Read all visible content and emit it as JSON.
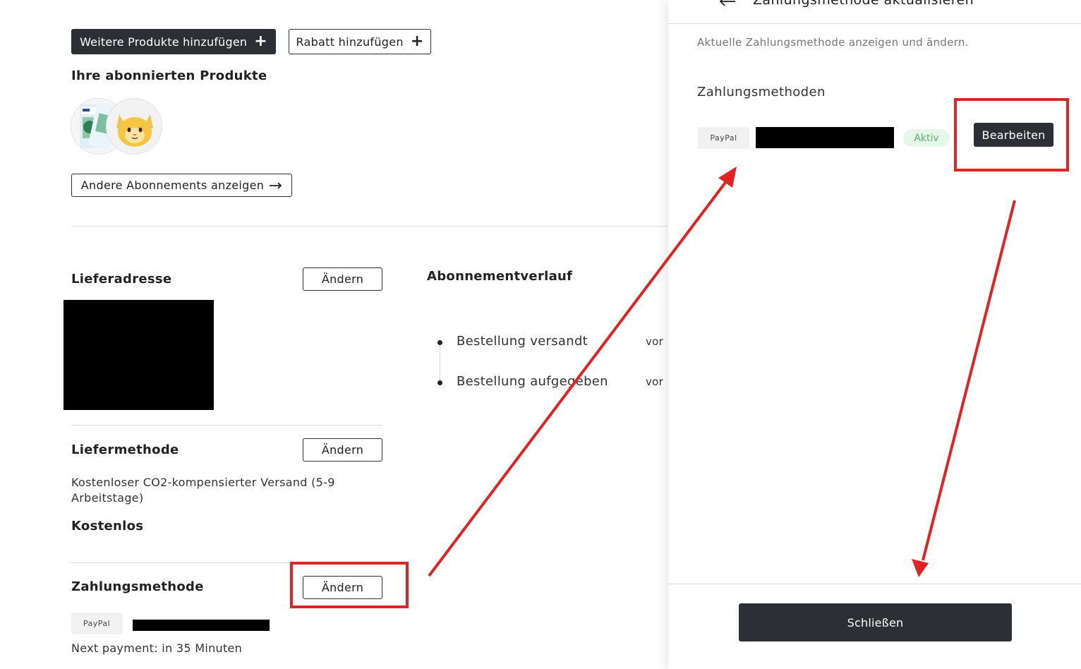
{
  "left": {
    "add_products_label": "Weitere Produkte hinzufügen",
    "add_discount_label": "Rabatt hinzufügen",
    "subscribed_products_title": "Ihre abonnierten Produkte",
    "other_subscriptions_label": "Andere Abonnements anzeigen",
    "shipping_address_title": "Lieferadresse",
    "change_label": "Ändern",
    "delivery_method_title": "Liefermethode",
    "delivery_method_text": "Kostenloser CO2-kompensierter Versand (5-9 Arbeitstage)",
    "delivery_price": "Kostenlos",
    "payment_method_title": "Zahlungsmethode",
    "paypal_label": "PayPal",
    "next_payment": "Next payment: in 35 Minuten"
  },
  "history": {
    "title": "Abonnementverlauf",
    "items": [
      {
        "label": "Bestellung versandt",
        "time": "vor"
      },
      {
        "label": "Bestellung aufgegeben",
        "time": "vor"
      }
    ]
  },
  "drawer": {
    "title": "Zahlungsmethode aktualisieren",
    "subtitle": "Aktuelle Zahlungsmethode anzeigen und ändern.",
    "methods_title": "Zahlungsmethoden",
    "paypal_label": "PayPal",
    "status": "Aktiv",
    "edit_label": "Bearbeiten",
    "close_label": "Schließen"
  },
  "icons": {
    "back": "arrow-left-icon",
    "plus": "plus-icon",
    "arrow_right": "arrow-right-icon"
  },
  "colors": {
    "button_dark": "#2c2f33",
    "annotation_red": "#e02424",
    "active_green": "#54b96a"
  }
}
